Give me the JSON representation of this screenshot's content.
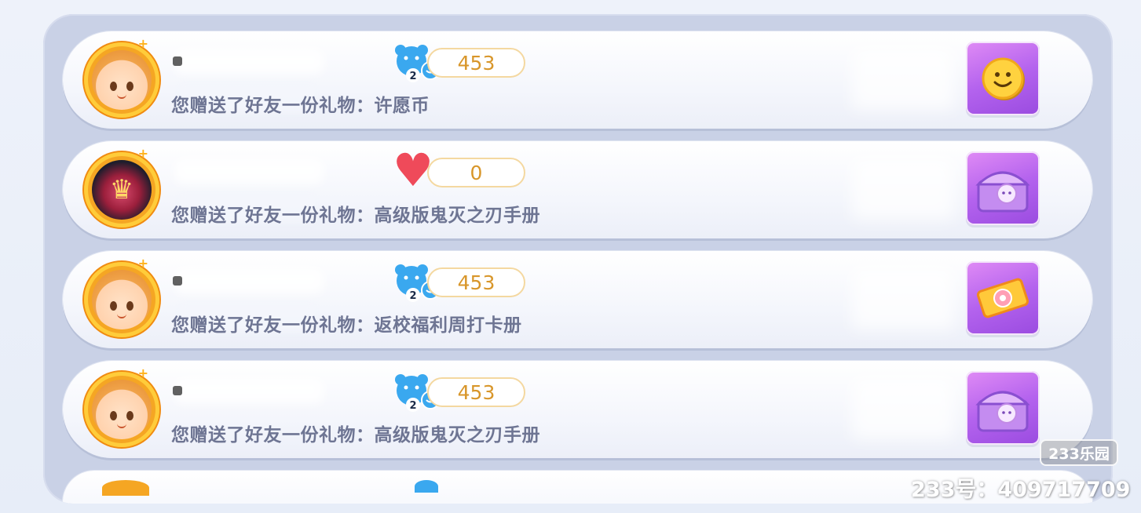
{
  "rows": [
    {
      "avatar": "boy-avatar-icon",
      "reaction_icon": "bear-level-2-icon",
      "reaction_level": "2",
      "score": "453",
      "description": "您赠送了好友一份礼物：许愿币",
      "gift_icon": "wish-coin-icon"
    },
    {
      "avatar": "crown-avatar-icon",
      "reaction_icon": "heart-icon",
      "reaction_level": "",
      "score": "0",
      "description": "您赠送了好友一份礼物：高级版鬼灭之刃手册",
      "gift_icon": "treasure-chest-icon"
    },
    {
      "avatar": "boy-avatar-icon",
      "reaction_icon": "bear-level-2-icon",
      "reaction_level": "2",
      "score": "453",
      "description": "您赠送了好友一份礼物：返校福利周打卡册",
      "gift_icon": "ticket-card-icon"
    },
    {
      "avatar": "boy-avatar-icon",
      "reaction_icon": "bear-level-2-icon",
      "reaction_level": "2",
      "score": "453",
      "description": "您赠送了好友一份礼物：高级版鬼灭之刃手册",
      "gift_icon": "treasure-chest-icon"
    }
  ],
  "watermark": {
    "logo": "233乐园",
    "id_text": "233号：409717709"
  },
  "colors": {
    "panel": "#c9d1e6",
    "score_text": "#d8962a",
    "desc_text": "#6e7593",
    "gift_bg": "#b463ee",
    "heart": "#ef4a5a",
    "bear": "#3aa8ef"
  }
}
